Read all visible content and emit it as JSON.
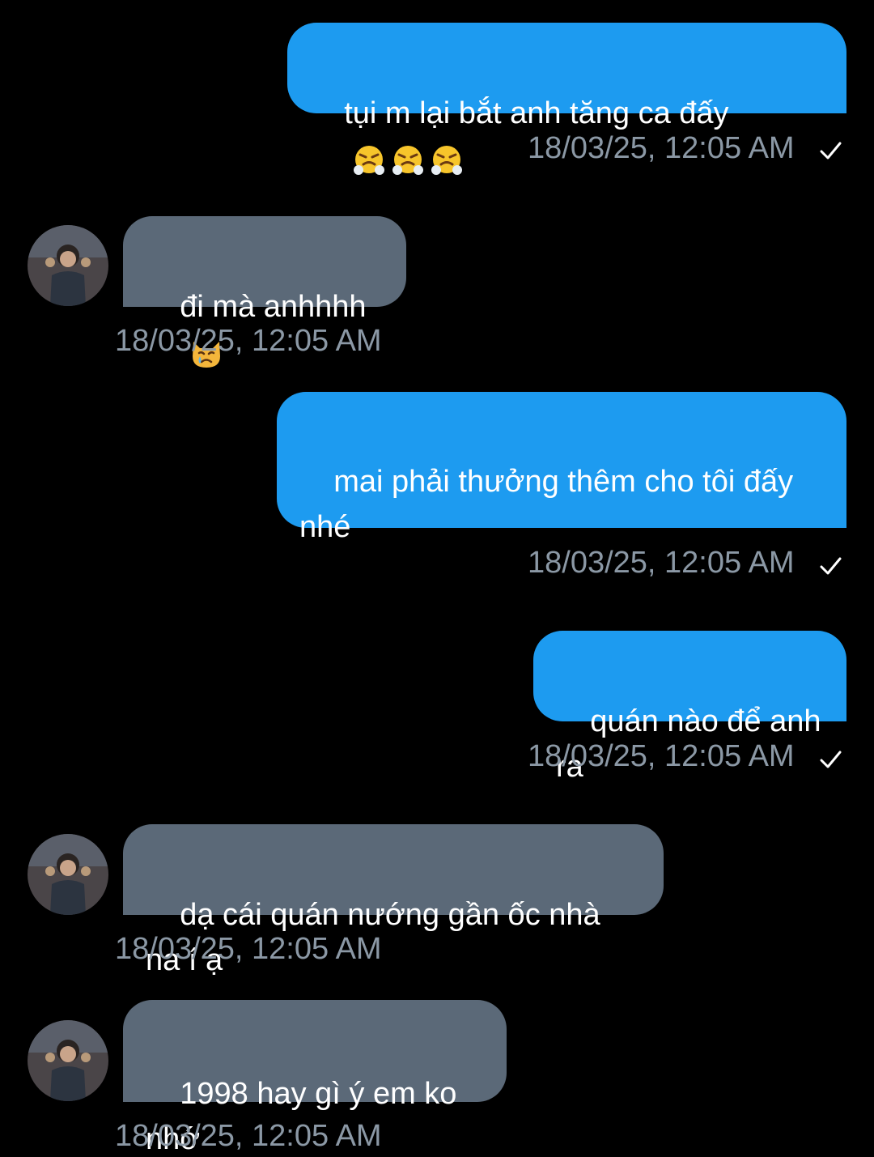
{
  "messages": [
    {
      "direction": "out",
      "text": "tụi m lại bắt anh tăng ca đấy",
      "emojis": [
        "angry-steam-face-icon",
        "angry-steam-face-icon",
        "angry-steam-face-icon"
      ],
      "time": "18/03/25, 12:05 AM",
      "status": "sent-check-icon"
    },
    {
      "direction": "in",
      "text": "đi mà anhhhh",
      "emojis": [
        "crying-cat-face-icon"
      ],
      "time": "18/03/25, 12:05 AM"
    },
    {
      "direction": "out",
      "text": "mai phải thưởng thêm cho tôi đấy\nnhé",
      "time": "18/03/25, 12:05 AM",
      "status": "sent-check-icon"
    },
    {
      "direction": "out",
      "text": "quán nào để anh ra",
      "time": "18/03/25, 12:05 AM",
      "status": "sent-check-icon"
    },
    {
      "direction": "in",
      "text": "dạ cái quán nướng gần ốc nhà na í ạ",
      "time": "18/03/25, 12:05 AM"
    },
    {
      "direction": "in",
      "text": "1998 hay gì ý em ko nhớ",
      "time": "18/03/25, 12:05 AM"
    }
  ],
  "colors": {
    "background": "#000000",
    "outgoing_bubble": "#1d9bf0",
    "incoming_bubble": "#5b6978",
    "timestamp": "#8b98a5"
  }
}
